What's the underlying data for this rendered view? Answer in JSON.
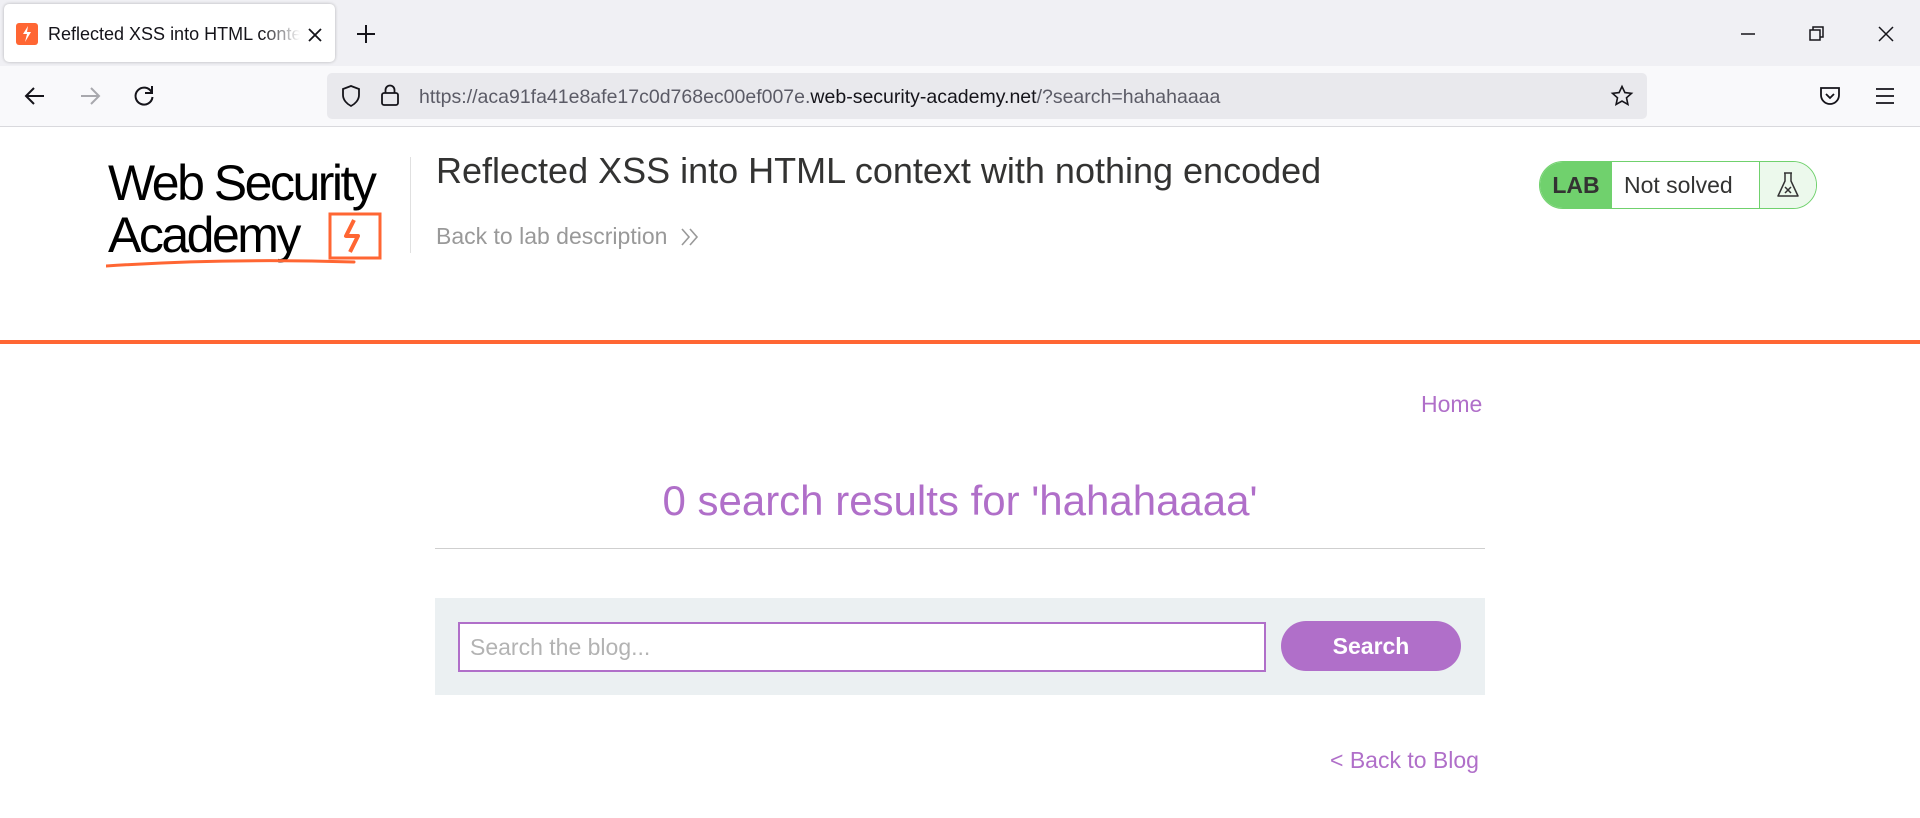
{
  "browser": {
    "tab_title": "Reflected XSS into HTML context with nothing encoded",
    "url_prefix": "https://aca91fa41e8afe17c0d768ec00ef007e.",
    "url_domain": "web-security-academy.net",
    "url_suffix": "/?search=hahahaaaa"
  },
  "header": {
    "logo_line1": "Web Security",
    "logo_line2": "Academy",
    "lab_title": "Reflected XSS into HTML context with nothing encoded",
    "back_description": "Back to lab description",
    "lab_badge": "LAB",
    "lab_status": "Not solved"
  },
  "colors": {
    "accent_orange": "#ff6633",
    "link_purple": "#b06fc9",
    "lab_green": "#70d16d",
    "search_panel_bg": "#ebf0f2"
  },
  "nav": {
    "home": "Home"
  },
  "main": {
    "results_heading": "0 search results for 'hahahaaaa'",
    "search_placeholder": "Search the blog...",
    "search_value": "",
    "search_button": "Search",
    "back_to_blog": "< Back to Blog"
  }
}
